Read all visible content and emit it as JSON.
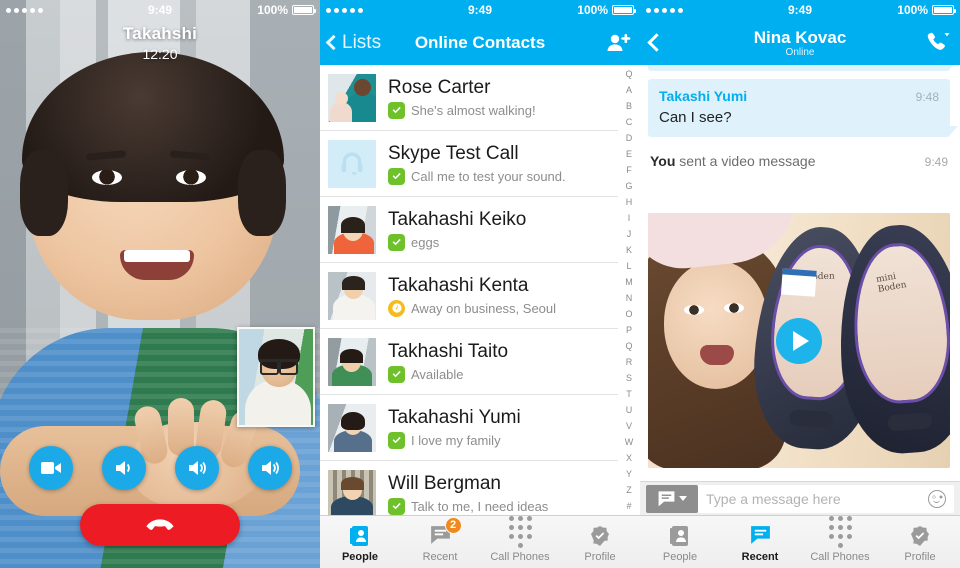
{
  "status_bar": {
    "signal_dots": 5,
    "time": "9:49",
    "battery_percent": "100%"
  },
  "call_screen": {
    "contact_name": "Takahshi",
    "duration": "12:20",
    "controls": [
      {
        "name": "video-toggle",
        "icon": "video-camera-icon"
      },
      {
        "name": "mute-toggle",
        "icon": "speaker-low-icon"
      },
      {
        "name": "volume",
        "icon": "speaker-medium-icon"
      },
      {
        "name": "speaker",
        "icon": "speaker-high-icon"
      }
    ],
    "end_call": {
      "label": "",
      "icon": "hangup-phone-icon",
      "color": "#ED1C24"
    },
    "pip_label": "self-view"
  },
  "contacts_screen": {
    "back_label": "Lists",
    "title": "Online Contacts",
    "add_contact_icon": "add-person-icon",
    "index_letters": [
      "Q",
      "A",
      "B",
      "C",
      "D",
      "E",
      "F",
      "G",
      "H",
      "I",
      "J",
      "K",
      "L",
      "M",
      "N",
      "O",
      "P",
      "Q",
      "R",
      "S",
      "T",
      "U",
      "V",
      "W",
      "X",
      "Y",
      "Z",
      "#"
    ],
    "contacts": [
      {
        "name": "Rose Carter",
        "status_text": "She's almost walking!",
        "presence": "online",
        "avatar": "mother-and-baby"
      },
      {
        "name": "Skype Test Call",
        "status_text": "Call me to test your sound.",
        "presence": "online",
        "avatar": "headset-icon"
      },
      {
        "name": "Takahashi Keiko",
        "status_text": "eggs",
        "presence": "online",
        "avatar": "woman-orange-top"
      },
      {
        "name": "Takahashi Kenta",
        "status_text": "Away on business, Seoul",
        "presence": "away",
        "avatar": "man-white-coat"
      },
      {
        "name": "Takhashi Taito",
        "status_text": "Available",
        "presence": "online",
        "avatar": "boy-green-top"
      },
      {
        "name": "Takahashi Yumi",
        "status_text": "I love my family",
        "presence": "online",
        "avatar": "woman-blue-top"
      },
      {
        "name": "Will Bergman",
        "status_text": "Talk to me, I need ideas",
        "presence": "online",
        "avatar": "man-denim-shirt"
      }
    ],
    "tabs": [
      {
        "label": "People",
        "icon": "contact-book-icon",
        "active": true,
        "badge": null
      },
      {
        "label": "Recent",
        "icon": "chat-bubble-icon",
        "active": false,
        "badge": "2"
      },
      {
        "label": "Call Phones",
        "icon": "dialpad-icon",
        "active": false,
        "badge": null
      },
      {
        "label": "Profile",
        "icon": "check-badge-icon",
        "active": false,
        "badge": null
      }
    ]
  },
  "chat_screen": {
    "back_icon": "chevron-left-icon",
    "contact_name": "Nina Kovac",
    "presence_text": "Online",
    "call_icon": "call-with-options-icon",
    "messages": [
      {
        "type": "bubble",
        "sender": "Takashi Yumi",
        "text": "Can I see?",
        "time": "9:48"
      },
      {
        "type": "system",
        "sender": "You",
        "text": " sent a video message",
        "time": "9:49"
      },
      {
        "type": "video",
        "play_icon": "play-icon",
        "caption": "video-message-thumbnail"
      }
    ],
    "composer": {
      "type_selector_icon": "message-type-icon",
      "placeholder": "Type a message here",
      "emoji_icon": "smiley-icon"
    },
    "tabs": [
      {
        "label": "People",
        "icon": "contact-book-icon",
        "active": false,
        "badge": null
      },
      {
        "label": "Recent",
        "icon": "chat-bubble-icon",
        "active": true,
        "badge": null
      },
      {
        "label": "Call Phones",
        "icon": "dialpad-icon",
        "active": false,
        "badge": null
      },
      {
        "label": "Profile",
        "icon": "check-badge-icon",
        "active": false,
        "badge": null
      }
    ]
  },
  "colors": {
    "skype_blue": "#00AFF0",
    "online_green": "#6FC12C",
    "away_yellow": "#F6BB1C",
    "badge_orange": "#F08A1E",
    "end_call_red": "#ED1C24",
    "bubble_blue": "#DFF1FA"
  }
}
